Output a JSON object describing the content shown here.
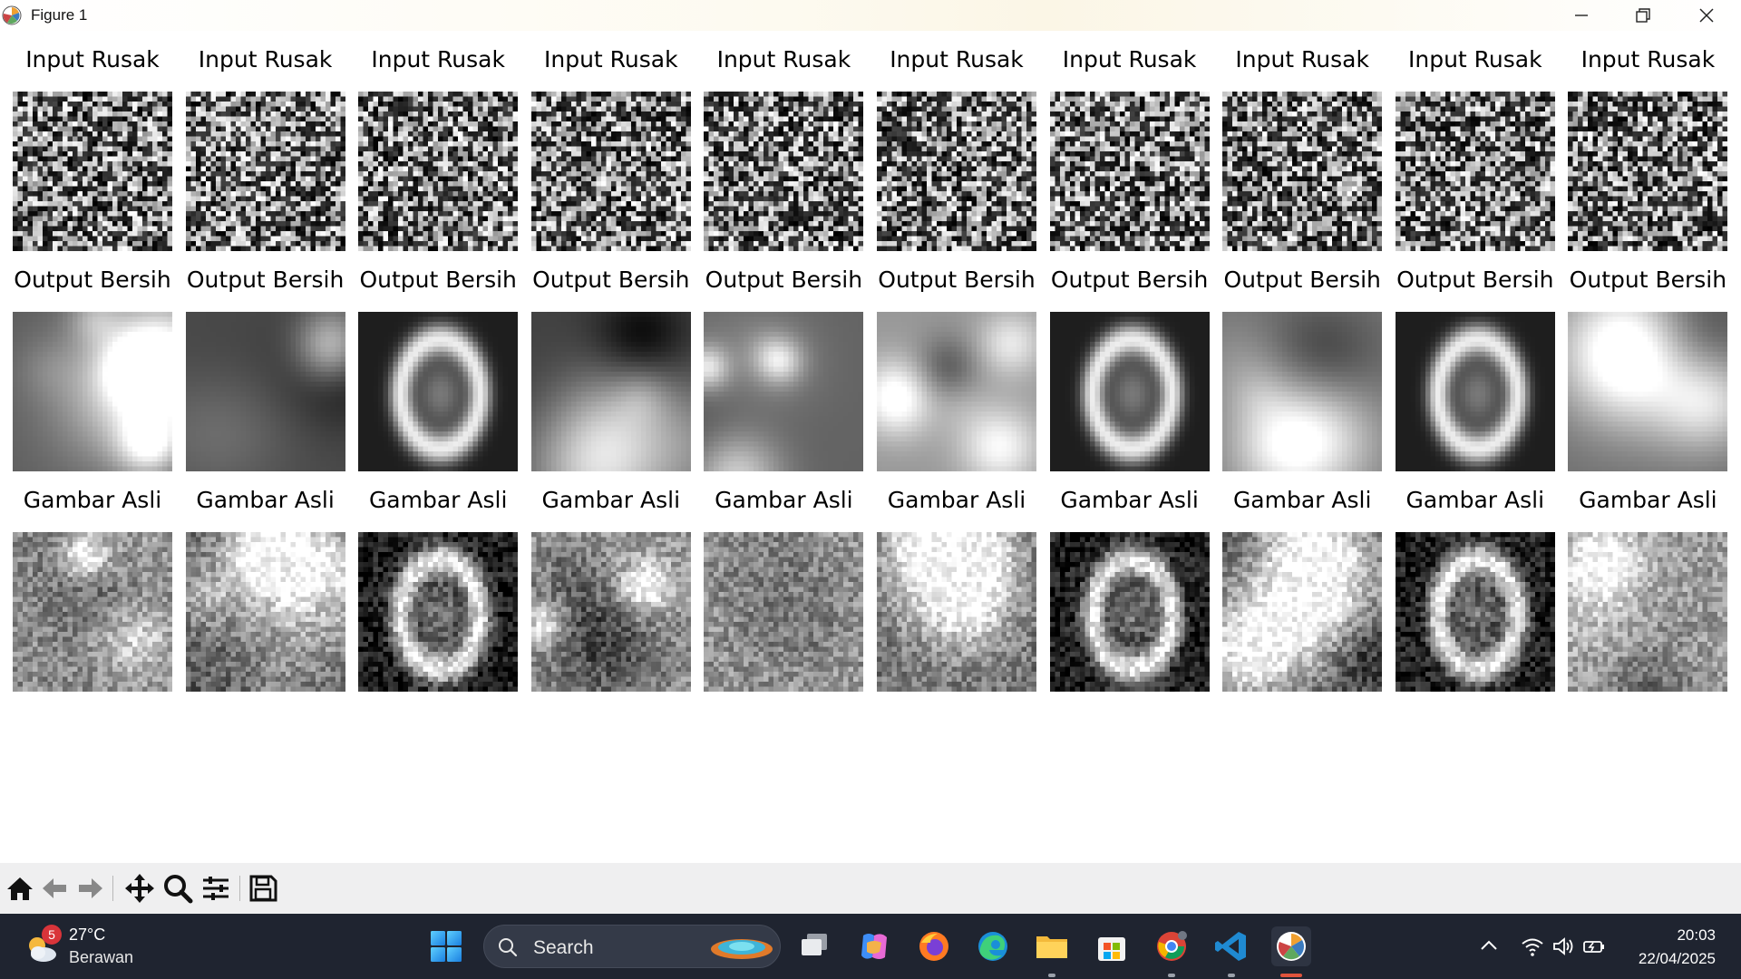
{
  "window": {
    "title": "Figure 1",
    "icons": [
      "matplotlib-app-icon",
      "minimize-icon",
      "restore-icon",
      "close-icon"
    ]
  },
  "figure": {
    "rows": [
      {
        "title": "Input Rusak",
        "kind": "noise"
      },
      {
        "title": "Output Bersih",
        "kind": "smooth"
      },
      {
        "title": "Gambar Asli",
        "kind": "detail"
      }
    ],
    "columns": 10,
    "image_resolution": "32x32 grayscale",
    "colormap": "gray"
  },
  "toolbar": {
    "buttons": [
      "home-icon",
      "back-icon",
      "forward-icon",
      "pan-icon",
      "zoom-icon",
      "configure-subplots-icon",
      "save-icon"
    ]
  },
  "taskbar": {
    "weather": {
      "badge": "5",
      "temperature": "27°C",
      "description": "Berawan"
    },
    "search": {
      "placeholder": "Search"
    },
    "apps": [
      "task-view",
      "copilot",
      "firefox",
      "edge",
      "file-explorer",
      "microsoft-store",
      "chrome",
      "vscode",
      "matplotlib"
    ],
    "clock": {
      "time": "20:03",
      "date": "22/04/2025"
    }
  }
}
